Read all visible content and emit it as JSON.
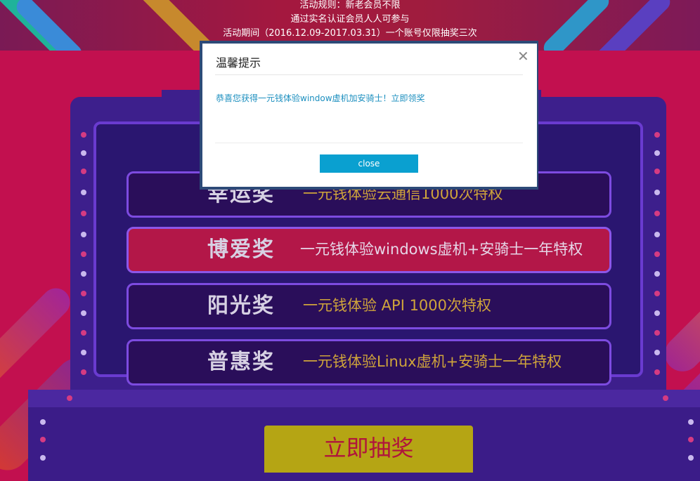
{
  "rules": {
    "line1": "活动规则：新老会员不限",
    "line2": "通过实名认证会员人人可参与",
    "line3": "活动期间（2016.12.09-2017.03.31）一个账号仅限抽奖三次"
  },
  "prizes": [
    {
      "name": "幸运奖",
      "desc": "一元钱体验云通信1000次特权"
    },
    {
      "name": "博爱奖",
      "desc": "一元钱体验windows虚机+安骑士一年特权"
    },
    {
      "name": "阳光奖",
      "desc": "一元钱体验 API 1000次特权"
    },
    {
      "name": "普惠奖",
      "desc": "一元钱体验Linux虚机+安骑士一年特权"
    }
  ],
  "draw_button": {
    "label": "立即抽奖"
  },
  "modal": {
    "title": "温馨提示",
    "close_glyph": "✕",
    "message": "恭喜您获得一元钱体验window虚机加安骑士！立即领奖",
    "button_label": "close"
  },
  "colors": {
    "page_bg": "#c2104f",
    "machine": "#3d1f8c",
    "highlight_prize": "#b31748",
    "prize_desc": "#cfa43b",
    "draw_button": "#b5a514",
    "modal_link": "#1c8fbf",
    "modal_button": "#0aa0d0"
  }
}
